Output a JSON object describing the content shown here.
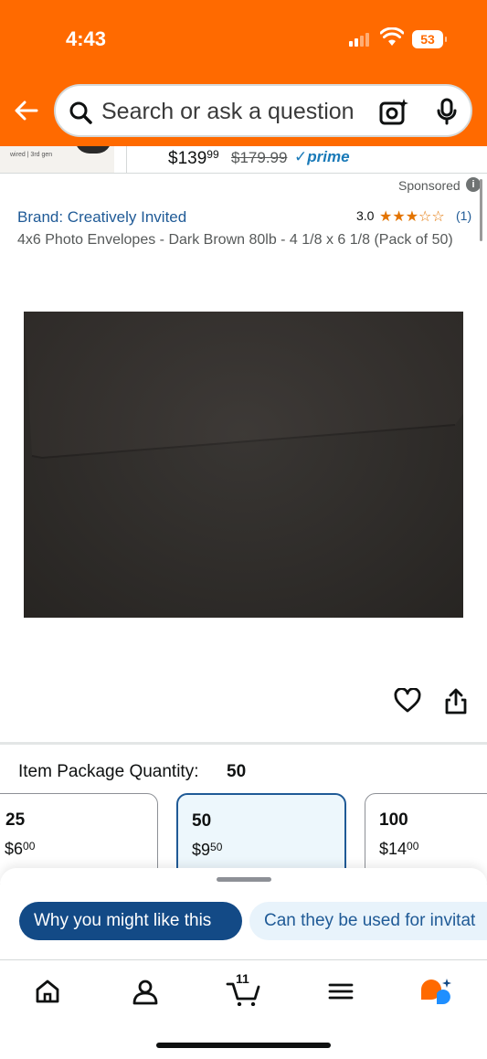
{
  "status_bar": {
    "time": "4:43",
    "battery": "53"
  },
  "header": {
    "search_placeholder": "Search or ask a question"
  },
  "sponsored_ad": {
    "thumb_label": "wired | 3rd gen",
    "price_whole": "139",
    "price_fraction": "99",
    "list_price": "$179.99",
    "prime": "prime"
  },
  "product": {
    "sponsored_label": "Sponsored",
    "brand": "Brand: Creatively Invited",
    "rating": "3.0",
    "stars": "★★★☆☆",
    "rating_count": "(1)",
    "title": "4x6 Photo Envelopes - Dark Brown 80lb - 4 1/8 x 6 1/8 (Pack of 50)"
  },
  "quantity": {
    "label": "Item Package Quantity:",
    "selected": "50",
    "options": [
      {
        "count": "25",
        "price_whole": "6",
        "price_fraction": "00"
      },
      {
        "count": "50",
        "price_whole": "9",
        "price_fraction": "50"
      },
      {
        "count": "100",
        "price_whole": "14",
        "price_fraction": "00"
      }
    ]
  },
  "suggestions": {
    "chip1": "Why you might like this",
    "chip2": "Can they be used for invitat"
  },
  "nav": {
    "cart_count": "11"
  },
  "colors": {
    "header": "#ff6a00",
    "accent_blue": "#1f5a96",
    "star": "#e37400"
  }
}
